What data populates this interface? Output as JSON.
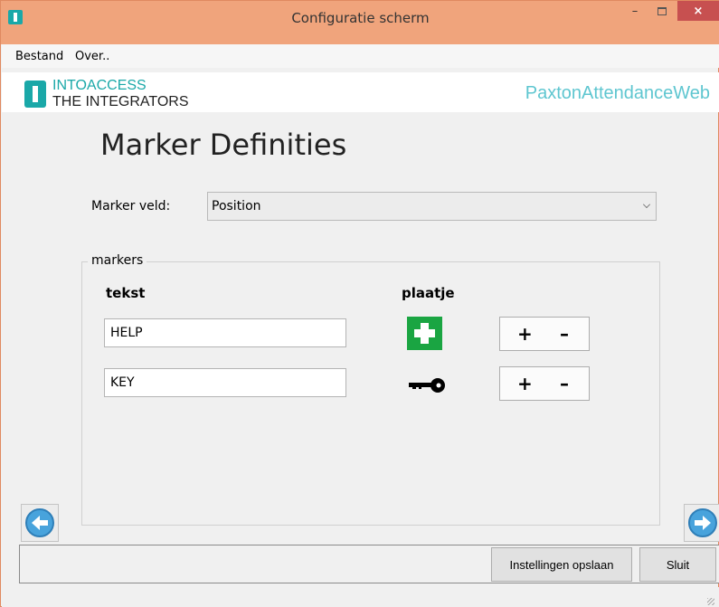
{
  "window": {
    "title": "Configuratie scherm",
    "minimize": "–",
    "close": "×"
  },
  "menu": {
    "items": [
      "Bestand",
      "Over.."
    ]
  },
  "banner": {
    "logo_line1": "INTOACCESS",
    "logo_line2": "THE INTEGRATORS",
    "app_name": "PaxtonAttendanceWeb"
  },
  "page": {
    "heading": "Marker Definities"
  },
  "marker_field": {
    "label": "Marker veld:",
    "selected": "Position"
  },
  "markers": {
    "legend": "markers",
    "col_text": "tekst",
    "col_image": "plaatje",
    "rows": [
      {
        "text": "HELP",
        "icon": "first-aid-cross-icon",
        "plus": "+",
        "minus": "–"
      },
      {
        "text": "KEY",
        "icon": "key-icon",
        "plus": "+",
        "minus": "–"
      }
    ]
  },
  "footer": {
    "save_label": "Instellingen opslaan",
    "close_label": "Sluit"
  },
  "colors": {
    "title_bar": "#f0a47c",
    "accent": "#1aa8a8",
    "app_name": "#5ec6d0",
    "first_aid": "#1aa542",
    "nav_button": "#48a3dc"
  }
}
